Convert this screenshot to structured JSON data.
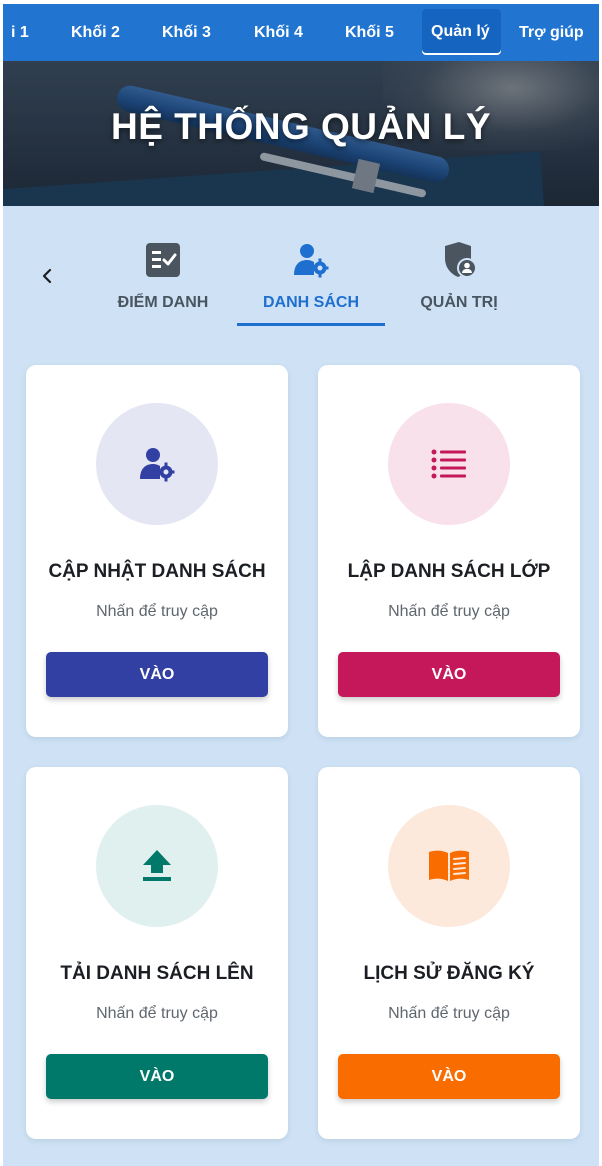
{
  "nav": {
    "items": [
      {
        "label": "i 1",
        "active": false
      },
      {
        "label": "Khối 2",
        "active": false
      },
      {
        "label": "Khối 3",
        "active": false
      },
      {
        "label": "Khối 4",
        "active": false
      },
      {
        "label": "Khối 5",
        "active": false
      },
      {
        "label": "Quản lý",
        "active": true
      },
      {
        "label": "Trợ giúp",
        "active": false
      }
    ]
  },
  "hero": {
    "title": "HỆ THỐNG QUẢN LÝ"
  },
  "tabs": {
    "prev_icon": "chevron-left-icon",
    "items": [
      {
        "label": "ĐIỂM DANH",
        "icon": "checklist-icon",
        "active": false
      },
      {
        "label": "DANH SÁCH",
        "icon": "user-gear-icon",
        "active": true
      },
      {
        "label": "QUẢN TRỊ",
        "icon": "shield-user-icon",
        "active": false
      }
    ]
  },
  "cards": [
    {
      "title": "CẬP NHẬT DANH SÁCH",
      "subtitle": "Nhấn để truy cập",
      "button": "VÀO",
      "icon": "user-gear-icon",
      "color": "#3340a3",
      "circle": "#e4e6f4"
    },
    {
      "title": "LẬP DANH SÁCH LỚP",
      "subtitle": "Nhấn để truy cập",
      "button": "VÀO",
      "icon": "list-icon",
      "color": "#c5185b",
      "circle": "#f8e1ea"
    },
    {
      "title": "TẢI DANH SÁCH LÊN",
      "subtitle": "Nhấn để truy cập",
      "button": "VÀO",
      "icon": "upload-icon",
      "color": "#00796b",
      "circle": "#dff0ee"
    },
    {
      "title": "LỊCH SỬ ĐĂNG KÝ",
      "subtitle": "Nhấn để truy cập",
      "button": "VÀO",
      "icon": "book-icon",
      "color": "#f96d00",
      "circle": "#fde9db"
    }
  ]
}
